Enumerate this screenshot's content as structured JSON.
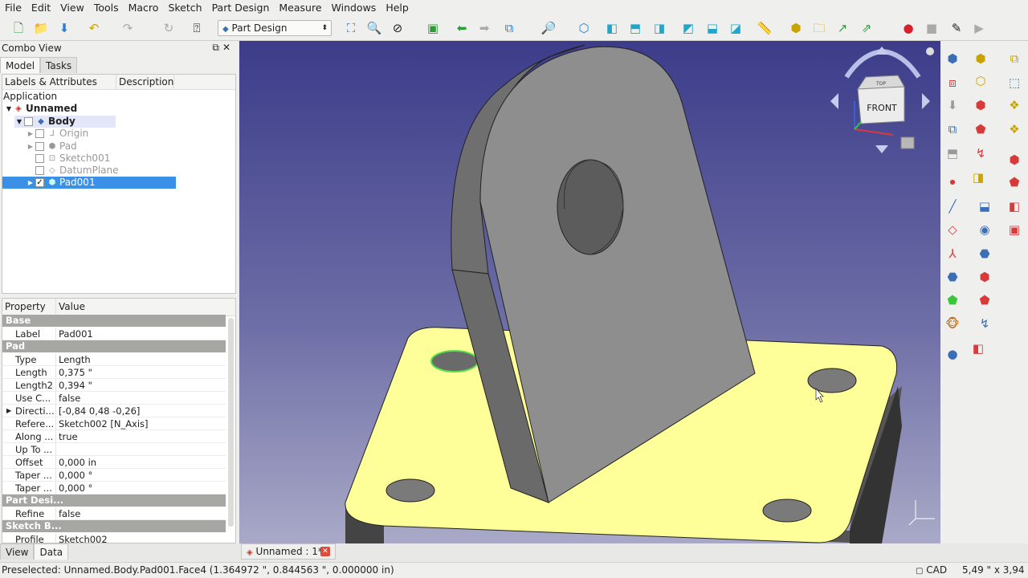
{
  "menu": [
    "File",
    "Edit",
    "View",
    "Tools",
    "Macro",
    "Sketch",
    "Part Design",
    "Measure",
    "Windows",
    "Help"
  ],
  "workbench": "Part Design",
  "combo": {
    "title": "Combo View",
    "tabs": [
      "Model",
      "Tasks"
    ],
    "tree_headers": [
      "Labels & Attributes",
      "Description"
    ],
    "tree": {
      "application": "Application",
      "document": "Unnamed",
      "body": "Body",
      "items": [
        "Origin",
        "Pad",
        "Sketch001",
        "DatumPlane",
        "Pad001"
      ]
    },
    "prop_headers": [
      "Property",
      "Value"
    ],
    "groups": {
      "base": "Base",
      "pad": "Pad",
      "part_design": "Part Desi...",
      "sketch_based": "Sketch B..."
    },
    "props": [
      {
        "k": "Label",
        "v": "Pad001"
      },
      {
        "k": "Type",
        "v": "Length"
      },
      {
        "k": "Length",
        "v": "0,375 \""
      },
      {
        "k": "Length2",
        "v": "0,394 \""
      },
      {
        "k": "Use C...",
        "v": "false"
      },
      {
        "k": "Directi...",
        "v": "[-0,84 0,48 -0,26]"
      },
      {
        "k": "Refere...",
        "v": "Sketch002 [N_Axis]"
      },
      {
        "k": "Along ...",
        "v": "true"
      },
      {
        "k": "Up To ...",
        "v": ""
      },
      {
        "k": "Offset",
        "v": "0,000 in"
      },
      {
        "k": "Taper ...",
        "v": "0,000 °"
      },
      {
        "k": "Taper ...",
        "v": "0,000 °"
      },
      {
        "k": "Refine",
        "v": "false"
      },
      {
        "k": "Profile",
        "v": "Sketch002"
      }
    ],
    "bottom_tabs": [
      "View",
      "Data"
    ]
  },
  "navcube": {
    "face": "FRONT",
    "top": "TOP"
  },
  "document_tab": "Unnamed : 1*",
  "status": {
    "message": "Preselected: Unnamed.Body.Pad001.Face4 (1.364972 \", 0.844563 \", 0.000000 in)",
    "nav": "CAD",
    "dims": "5,49 \" x 3,94 \""
  },
  "colors": {
    "selection": "#3a8fe6",
    "highlight_face": "#ffff99",
    "part": "#909090"
  }
}
